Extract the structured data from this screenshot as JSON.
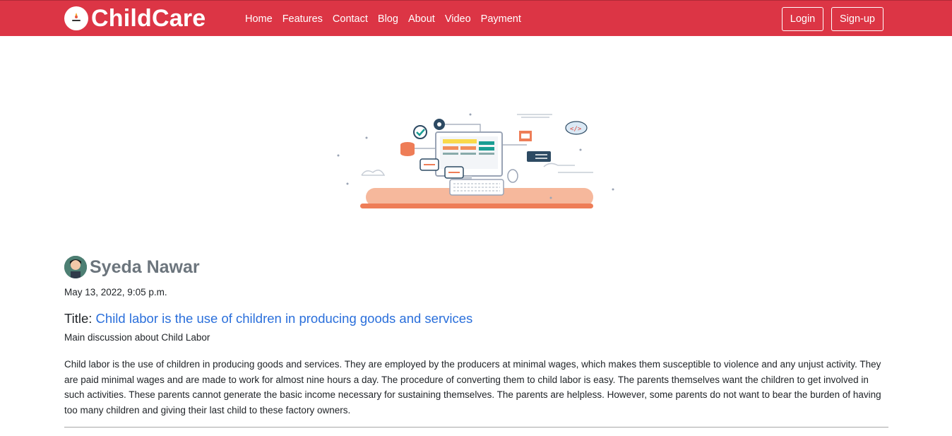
{
  "brand": {
    "name": "ChildCare",
    "logo_text": "ChildCare"
  },
  "nav": {
    "links": [
      "Home",
      "Features",
      "Contact",
      "Blog",
      "About",
      "Video",
      "Payment"
    ],
    "login_label": "Login",
    "signup_label": "Sign-up"
  },
  "hero": {
    "icon": "coding-illustration"
  },
  "post": {
    "author": "Syeda Nawar",
    "date": "May 13, 2022, 9:05 p.m.",
    "title_label": "Title:",
    "title": "Child labor is the use of children in producing goods and services",
    "description": "Main discussion about Child Labor",
    "body": "Child labor is the use of children in producing goods and services. They are employed by the producers at minimal wages, which makes them susceptible to violence and any unjust activity. They are paid minimal wages and are made to work for almost nine hours a day. The procedure of converting them to child labor is easy. The parents themselves want the children to get involved in such activities. These parents cannot generate the basic income necessary for sustaining themselves. The parents are helpless. However, some parents do not want to bear the burden of having too many children and giving their last child to these factory owners."
  },
  "colors": {
    "navbar": "#dc3545",
    "link": "#2a6fdb",
    "author": "#6c757d"
  }
}
